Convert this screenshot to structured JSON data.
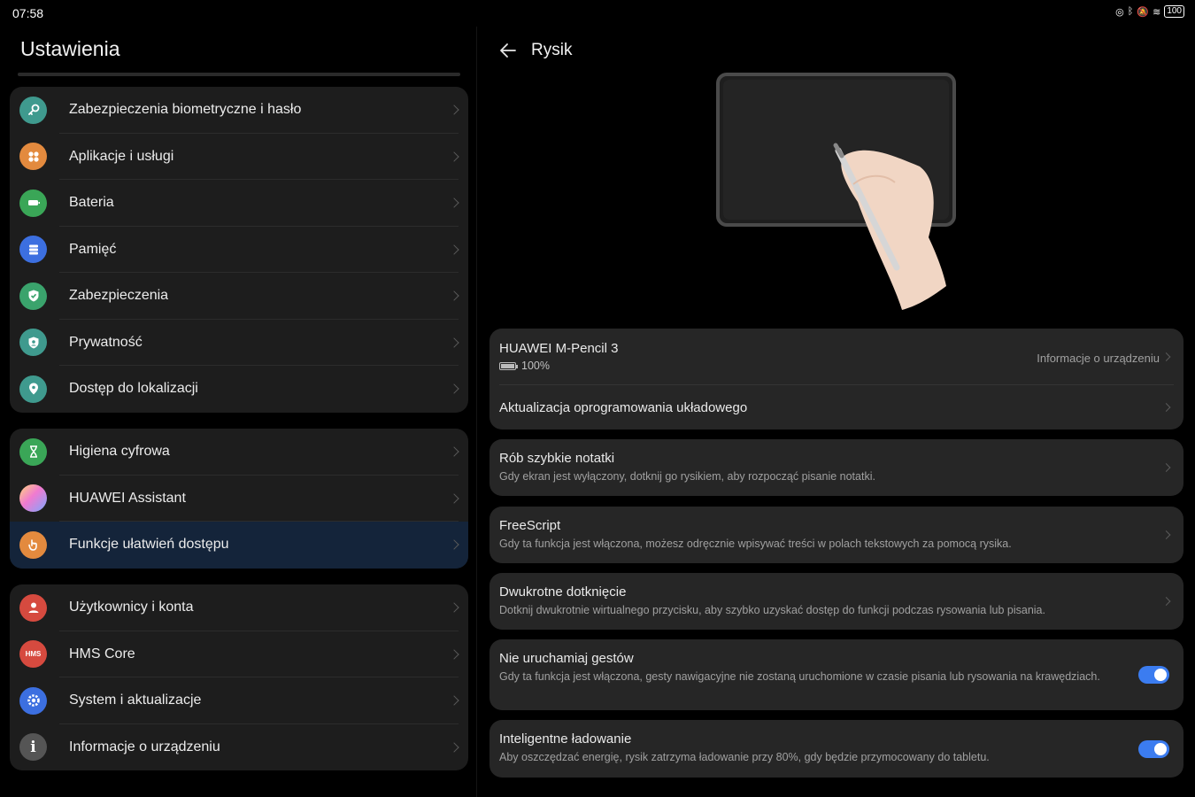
{
  "status": {
    "time": "07:58",
    "battery": "100"
  },
  "left": {
    "title": "Ustawienia",
    "groups": [
      [
        {
          "label": "Zabezpieczenia biometryczne i hasło",
          "icon": "key-icon",
          "color": "#3f9a8e"
        },
        {
          "label": "Aplikacje i usługi",
          "icon": "apps-icon",
          "color": "#e38a3e"
        },
        {
          "label": "Bateria",
          "icon": "battery-icon",
          "color": "#3aa657"
        },
        {
          "label": "Pamięć",
          "icon": "storage-icon",
          "color": "#3c6fe0"
        },
        {
          "label": "Zabezpieczenia",
          "icon": "shield-check-icon",
          "color": "#3aa36c"
        },
        {
          "label": "Prywatność",
          "icon": "privacy-shield-icon",
          "color": "#3f9a8e"
        },
        {
          "label": "Dostęp do lokalizacji",
          "icon": "location-pin-icon",
          "color": "#3f9a8e"
        }
      ],
      [
        {
          "label": "Higiena cyfrowa",
          "icon": "hourglass-icon",
          "color": "#3aa657"
        },
        {
          "label": "HUAWEI Assistant",
          "icon": "assistant-icon",
          "color": "#b07ad6"
        },
        {
          "label": "Funkcje ułatwień dostępu",
          "icon": "hand-icon",
          "color": "#e38a3e",
          "active": true
        }
      ],
      [
        {
          "label": "Użytkownicy i konta",
          "icon": "user-icon",
          "color": "#d64a3f"
        },
        {
          "label": "HMS Core",
          "icon": "hms-icon",
          "color": "#d64a3f",
          "badge": "HMS"
        },
        {
          "label": "System i aktualizacje",
          "icon": "gear-icon",
          "color": "#3c6fe0"
        },
        {
          "label": "Informacje o urządzeniu",
          "icon": "info-icon",
          "color": "#555555"
        }
      ]
    ]
  },
  "right": {
    "title": "Rysik",
    "device": {
      "name": "HUAWEI M-Pencil 3",
      "battery": "100%",
      "info_link": "Informacje o urządzeniu",
      "firmware": "Aktualizacja oprogramowania układowego"
    },
    "cards": [
      {
        "title": "Rób szybkie notatki",
        "sub": "Gdy ekran jest wyłączony, dotknij go rysikiem, aby rozpocząć pisanie notatki.",
        "control": "chevron"
      },
      {
        "title": "FreeScript",
        "sub": "Gdy ta funkcja jest włączona, możesz odręcznie wpisywać treści w polach tekstowych za pomocą rysika.",
        "control": "chevron"
      },
      {
        "title": "Dwukrotne dotknięcie",
        "sub": "Dotknij dwukrotnie wirtualnego przycisku, aby szybko uzyskać dostęp do funkcji podczas rysowania lub pisania.",
        "control": "chevron"
      },
      {
        "title": "Nie uruchamiaj gestów",
        "sub": "Gdy ta funkcja jest włączona, gesty nawigacyjne nie zostaną uruchomione w czasie pisania lub rysowania na krawędziach.",
        "control": "toggle",
        "on": true
      },
      {
        "title": "Inteligentne ładowanie",
        "sub": "Aby oszczędzać energię, rysik zatrzyma ładowanie przy 80%, gdy będzie przymocowany do tabletu.",
        "control": "toggle",
        "on": true
      }
    ]
  }
}
